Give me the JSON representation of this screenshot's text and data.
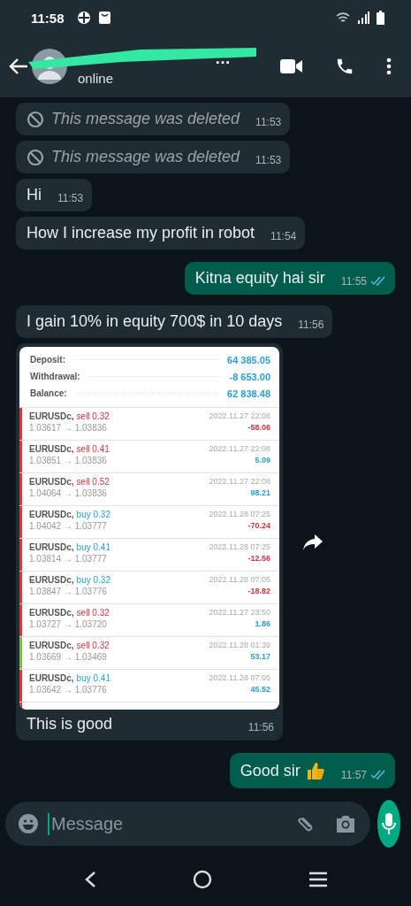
{
  "status_bar": {
    "time": "11:58"
  },
  "header": {
    "name": "…",
    "status": "online"
  },
  "messages": [
    {
      "kind": "deleted",
      "outgoing": false,
      "text": "This message was deleted",
      "time": "11:53"
    },
    {
      "kind": "deleted",
      "outgoing": false,
      "text": "This message was deleted",
      "time": "11:53"
    },
    {
      "kind": "text",
      "outgoing": false,
      "text": "Hi",
      "time": "11:53"
    },
    {
      "kind": "text",
      "outgoing": false,
      "text": "How I increase my profit in robot",
      "time": "11:54"
    },
    {
      "kind": "text",
      "outgoing": true,
      "text": "Kitna equity hai sir",
      "time": "11:55",
      "read": true
    },
    {
      "kind": "text",
      "outgoing": false,
      "text": "I gain 10% in equity 700$ in 10 days",
      "time": "11:56"
    },
    {
      "kind": "image",
      "outgoing": false,
      "text": "This is good",
      "time": "11:56",
      "summary": [
        {
          "label": "Deposit:",
          "value": "64 385.05"
        },
        {
          "label": "Withdrawal:",
          "value": "-8 653.00"
        },
        {
          "label": "Balance:",
          "value": "62 838.48"
        }
      ],
      "trades": [
        {
          "symbol": "EURUSDc,",
          "kind": "sell",
          "volume": "sell 0.32",
          "prices": "1.03617 → 1.03836",
          "date": "2022.11.27 22:08",
          "profit": "-58.06",
          "loss": true,
          "color": "#d9343f"
        },
        {
          "symbol": "EURUSDc,",
          "kind": "sell",
          "volume": "sell 0.41",
          "prices": "1.03851 → 1.03836",
          "date": "2022.11.27 22:08",
          "profit": "5.09",
          "loss": false,
          "color": "#d9343f"
        },
        {
          "symbol": "EURUSDc,",
          "kind": "sell",
          "volume": "sell 0.52",
          "prices": "1.04064 → 1.03836",
          "date": "2022.11.27 22:08",
          "profit": "98.21",
          "loss": false,
          "color": "#d9343f"
        },
        {
          "symbol": "EURUSDc,",
          "kind": "buy",
          "volume": "buy 0.32",
          "prices": "1.04042 → 1.03777",
          "date": "2022.11.28 07:25",
          "profit": "-70.24",
          "loss": true,
          "color": "#d9343f"
        },
        {
          "symbol": "EURUSDc,",
          "kind": "buy",
          "volume": "buy 0.41",
          "prices": "1.03814 → 1.03777",
          "date": "2022.11.28 07:25",
          "profit": "-12.56",
          "loss": true,
          "color": "#d9343f"
        },
        {
          "symbol": "EURUSDc,",
          "kind": "buy",
          "volume": "buy 0.32",
          "prices": "1.03847 → 1.03776",
          "date": "2022.11.28 07:05",
          "profit": "-18.82",
          "loss": true,
          "color": "#d9343f"
        },
        {
          "symbol": "EURUSDc,",
          "kind": "sell",
          "volume": "sell 0.32",
          "prices": "1.03727 → 1.03720",
          "date": "2022.11.27 23:50",
          "profit": "1.86",
          "loss": false,
          "color": "#d9343f"
        },
        {
          "symbol": "EURUSDc,",
          "kind": "sell",
          "volume": "sell 0.32",
          "prices": "1.03669 → 1.03469",
          "date": "2022.11.28 01:39",
          "profit": "53.17",
          "loss": false,
          "color": "#7cc242"
        },
        {
          "symbol": "EURUSDc,",
          "kind": "buy",
          "volume": "buy 0.41",
          "prices": "1.03642 → 1.03776",
          "date": "2022.11.28 07:05",
          "profit": "45.52",
          "loss": false,
          "color": "#d9343f"
        }
      ]
    },
    {
      "kind": "text",
      "outgoing": true,
      "text": "Good sir",
      "time": "11:57",
      "read": true,
      "thumbs_up": true
    }
  ],
  "composer": {
    "placeholder": "Message"
  }
}
